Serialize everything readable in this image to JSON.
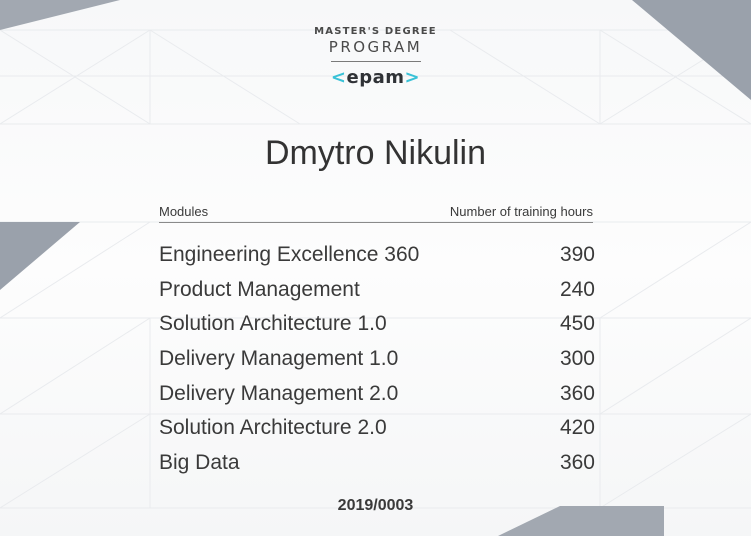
{
  "brand": {
    "line1": "MASTER'S DEGREE",
    "line2": "PROGRAM",
    "logo_left": "<",
    "logo_text": "epam",
    "logo_right": ">"
  },
  "recipient": {
    "name": "Dmytro Nikulin"
  },
  "table": {
    "header_modules": "Modules",
    "header_hours": "Number of training hours",
    "rows": [
      {
        "module": "Engineering Excellence 360",
        "hours": "390"
      },
      {
        "module": "Product Management",
        "hours": "240"
      },
      {
        "module": "Solution Architecture 1.0",
        "hours": "450"
      },
      {
        "module": "Delivery Management 1.0",
        "hours": "300"
      },
      {
        "module": "Delivery Management 2.0",
        "hours": "360"
      },
      {
        "module": "Solution Architecture 2.0",
        "hours": "420"
      },
      {
        "module": "Big Data",
        "hours": "360"
      }
    ]
  },
  "certificate_number": "2019/0003",
  "colors": {
    "accent": "#39c2d7",
    "corner_gray": "#9aa1ab",
    "text": "#333333"
  }
}
